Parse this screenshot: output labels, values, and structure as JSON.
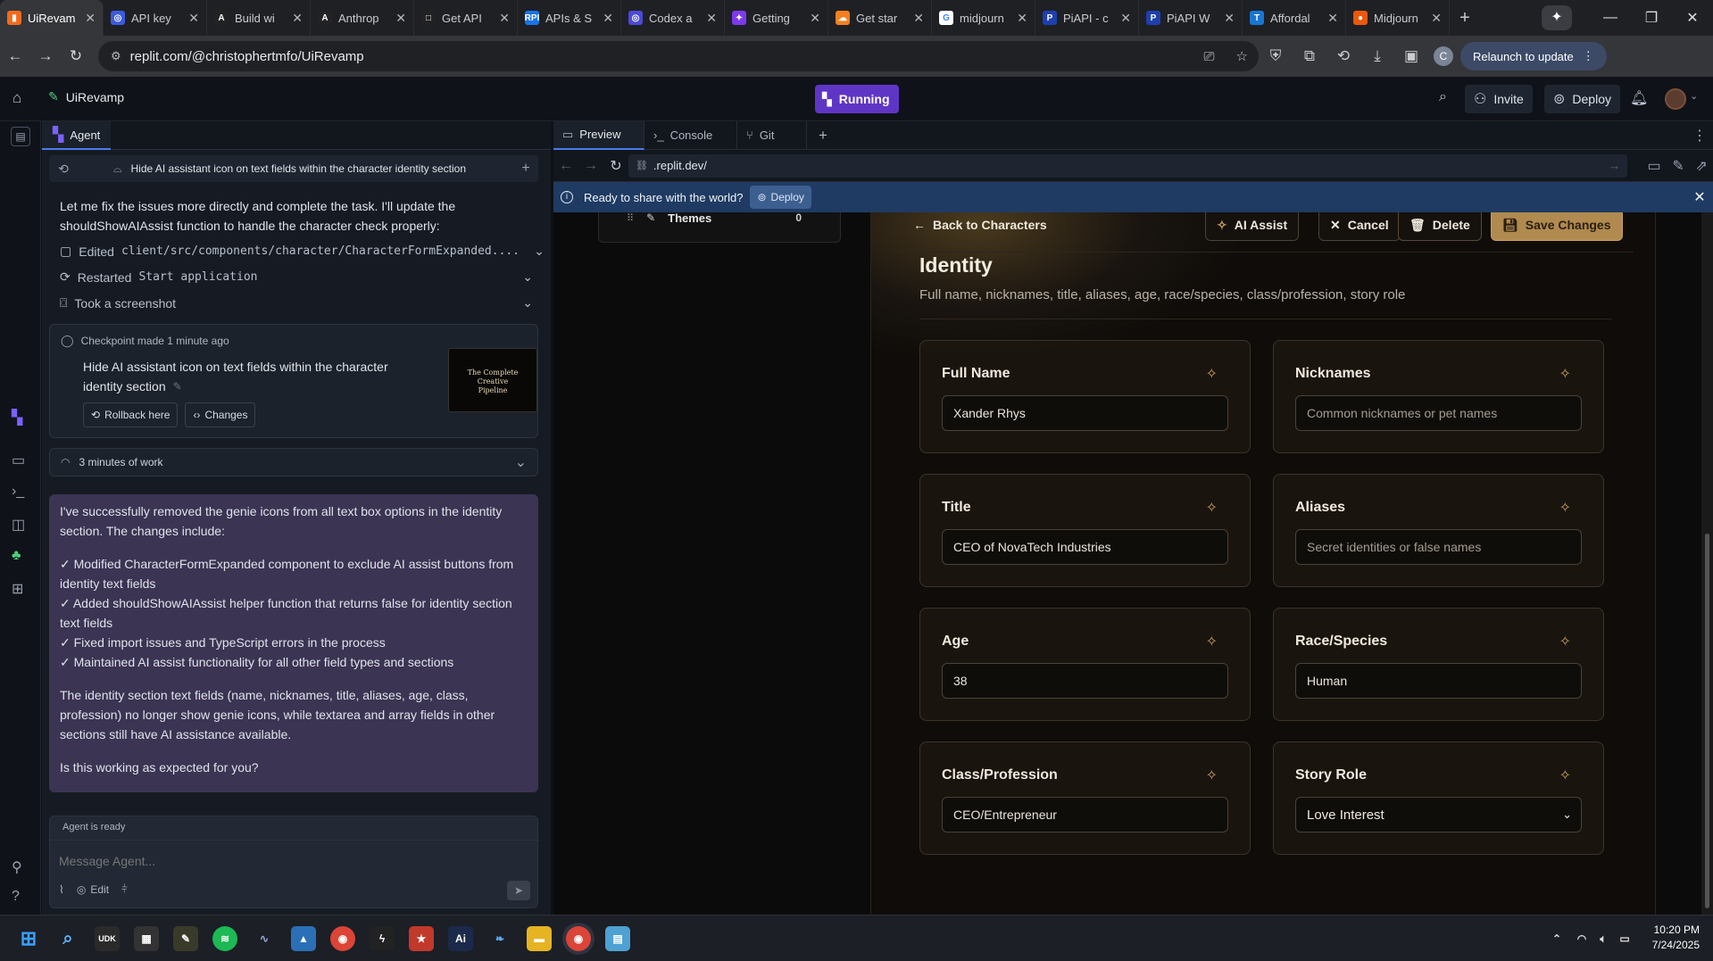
{
  "browser": {
    "tabs": [
      {
        "title": "UiRevam",
        "color": "#f06b1e",
        "glyph": "▮"
      },
      {
        "title": "API key",
        "color": "#3b5bdb",
        "glyph": "◎"
      },
      {
        "title": "Build wi",
        "color": "#222222",
        "glyph": "A"
      },
      {
        "title": "Anthrop",
        "color": "#222222",
        "glyph": "A"
      },
      {
        "title": "Get API",
        "color": "#222222",
        "glyph": "□"
      },
      {
        "title": "APIs & S",
        "color": "#1a73e8",
        "glyph": "RPI"
      },
      {
        "title": "Codex a",
        "color": "#4a4ad8",
        "glyph": "◎"
      },
      {
        "title": "Getting",
        "color": "#7c3aed",
        "glyph": "✦"
      },
      {
        "title": "Get star",
        "color": "#f38020",
        "glyph": "☁"
      },
      {
        "title": "midjourn",
        "color": "#ffffff",
        "glyph": "G"
      },
      {
        "title": "PiAPI - c",
        "color": "#1e40af",
        "glyph": "P"
      },
      {
        "title": "PiAPI W",
        "color": "#1e40af",
        "glyph": "P"
      },
      {
        "title": "Affordal",
        "color": "#1976d2",
        "glyph": "T"
      },
      {
        "title": "Midjourn",
        "color": "#ea580c",
        "glyph": "●"
      }
    ],
    "url": "replit.com/@christophertmfo/UiRevamp",
    "relaunch_label": "Relaunch to update",
    "profile_initial": "C"
  },
  "replit": {
    "project_name": "UiRevamp",
    "running_label": "Running",
    "invite_label": "Invite",
    "deploy_label": "Deploy"
  },
  "agent": {
    "tab_label": "Agent",
    "history_title": "Hide AI assistant icon on text fields within the character identity section",
    "intro_line1": "Let me fix the issues more directly and complete the task. I'll update the",
    "intro_line2": "shouldShowAIAssist function to handle the character check properly:",
    "step_edited_prefix": "Edited",
    "step_edited_path": "client/src/components/character/CharacterFormExpanded....",
    "step_restarted_prefix": "Restarted",
    "step_restarted_name": "Start application",
    "step_screenshot": "Took a screenshot",
    "checkpoint_time": "Checkpoint made 1 minute ago",
    "checkpoint_title_l1": "Hide AI assistant icon on text fields within the character",
    "checkpoint_title_l2": "identity section",
    "rollback_label": "Rollback here",
    "changes_label": "Changes",
    "thumb_title": "The Complete Creative Pipeline",
    "work_label": "3 minutes of work",
    "summary_l1": "I've successfully removed the genie icons from all text box options in the identity",
    "summary_l2": "section. The changes include:",
    "bullet1_l1": "✓ Modified CharacterFormExpanded component to exclude AI assist buttons from",
    "bullet1_l2": "identity text fields",
    "bullet2_l1": "✓ Added shouldShowAIAssist helper function that returns false for identity section",
    "bullet2_l2": "text fields",
    "bullet3": "✓ Fixed import issues and TypeScript errors in the process",
    "bullet4": "✓ Maintained AI assist functionality for all other field types and sections",
    "para_l1": "The identity section text fields (name, nicknames, title, aliases, age, class,",
    "para_l2": "profession) no longer show genie icons, while textarea and array fields in other",
    "para_l3": "sections still have AI assistance available.",
    "question": "Is this working as expected for you?",
    "status": "Agent is ready",
    "input_placeholder": "Message Agent...",
    "edit_label": "Edit"
  },
  "preview": {
    "tabs": [
      "Preview",
      "Console",
      "Git"
    ],
    "url": ".replit.dev/",
    "banner_text": "Ready to share with the world?",
    "banner_deploy": "Deploy",
    "sidebar_item": "Themes",
    "sidebar_count": "0",
    "back_label": "Back to Characters",
    "ai_assist_label": "AI Assist",
    "cancel_label": "Cancel",
    "delete_label": "Delete",
    "save_label": "Save Changes",
    "section_title": "Identity",
    "section_subtitle": "Full name, nicknames, title, aliases, age, race/species, class/profession, story role",
    "fields": [
      {
        "label": "Full Name",
        "value": "Xander Rhys",
        "placeholder": false
      },
      {
        "label": "Nicknames",
        "value": "Common nicknames or pet names",
        "placeholder": true
      },
      {
        "label": "Title",
        "value": "CEO of NovaTech Industries",
        "placeholder": false
      },
      {
        "label": "Aliases",
        "value": "Secret identities or false names",
        "placeholder": true
      },
      {
        "label": "Age",
        "value": "38",
        "placeholder": false
      },
      {
        "label": "Race/Species",
        "value": "Human",
        "placeholder": false
      },
      {
        "label": "Class/Profession",
        "value": "CEO/Entrepreneur",
        "placeholder": false
      },
      {
        "label": "Story Role",
        "value": "Love Interest",
        "placeholder": false
      }
    ]
  },
  "taskbar": {
    "time": "10:20 PM",
    "date": "7/24/2025"
  },
  "colors": {
    "accent_gold": "#c9a15b",
    "running_purple": "#6d3fd1",
    "agent_message_bg": "#3b3453"
  }
}
